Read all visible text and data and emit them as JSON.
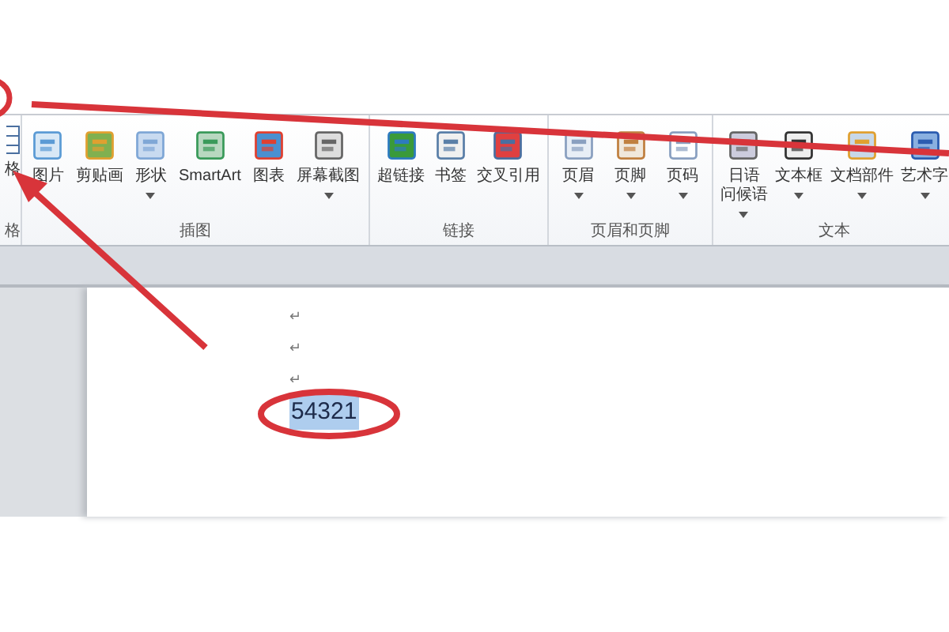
{
  "ribbon": {
    "partial_group": {
      "button_label": "格",
      "group_label": "格"
    },
    "groups": [
      {
        "label": "插图",
        "buttons": [
          {
            "label": "图片",
            "dropdown": false
          },
          {
            "label": "剪贴画",
            "dropdown": false
          },
          {
            "label": "形状",
            "dropdown": true
          },
          {
            "label": "SmartArt",
            "dropdown": false
          },
          {
            "label": "图表",
            "dropdown": false
          },
          {
            "label": "屏幕截图",
            "dropdown": true
          }
        ]
      },
      {
        "label": "链接",
        "buttons": [
          {
            "label": "超链接",
            "dropdown": false
          },
          {
            "label": "书签",
            "dropdown": false
          },
          {
            "label": "交叉引用",
            "dropdown": false
          }
        ]
      },
      {
        "label": "页眉和页脚",
        "buttons": [
          {
            "label": "页眉",
            "dropdown": true
          },
          {
            "label": "页脚",
            "dropdown": true
          },
          {
            "label": "页码",
            "dropdown": true
          }
        ]
      },
      {
        "label": "文本",
        "buttons": [
          {
            "label_lines": [
              "日语",
              "问候语"
            ],
            "dropdown": true
          },
          {
            "label": "文本框",
            "dropdown": true
          },
          {
            "label": "文档部件",
            "dropdown": true
          },
          {
            "label": "艺术字",
            "dropdown": true
          }
        ]
      }
    ]
  },
  "document": {
    "paragraph_marks": [
      "↵",
      "↵",
      "↵"
    ],
    "text": {
      "value": "54321",
      "selected": true
    }
  }
}
